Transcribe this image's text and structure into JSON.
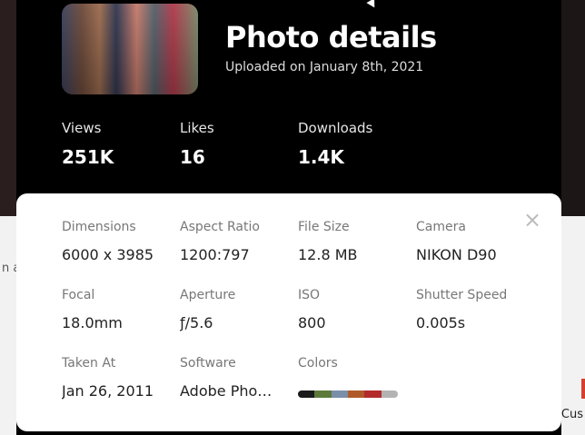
{
  "header": {
    "title": "Photo details",
    "uploaded": "Uploaded on January 8th, 2021"
  },
  "stats": [
    {
      "label": "Views",
      "value": "251K"
    },
    {
      "label": "Likes",
      "value": "16"
    },
    {
      "label": "Downloads",
      "value": "1.4K"
    }
  ],
  "details": {
    "dimensions": {
      "label": "Dimensions",
      "value": "6000 x 3985"
    },
    "aspect_ratio": {
      "label": "Aspect Ratio",
      "value": "1200:797"
    },
    "file_size": {
      "label": "File Size",
      "value": "12.8 MB"
    },
    "camera": {
      "label": "Camera",
      "value": "NIKON D90"
    },
    "focal": {
      "label": "Focal",
      "value": "18.0mm"
    },
    "aperture": {
      "label": "Aperture",
      "value": "ƒ/5.6"
    },
    "iso": {
      "label": "ISO",
      "value": "800"
    },
    "shutter_speed": {
      "label": "Shutter Speed",
      "value": "0.005s"
    },
    "taken_at": {
      "label": "Taken At",
      "value": "Jan 26, 2011"
    },
    "software": {
      "label": "Software",
      "value": "Adobe Photoshop"
    },
    "colors": {
      "label": "Colors",
      "swatches": [
        "#1b1b1b",
        "#5d7a3a",
        "#7a8fa8",
        "#b05a2a",
        "#b32b2b",
        "#b3b3b3"
      ]
    }
  },
  "close_icon": "×",
  "background": {
    "left_partial": "n a",
    "right_partial": "Cus"
  }
}
